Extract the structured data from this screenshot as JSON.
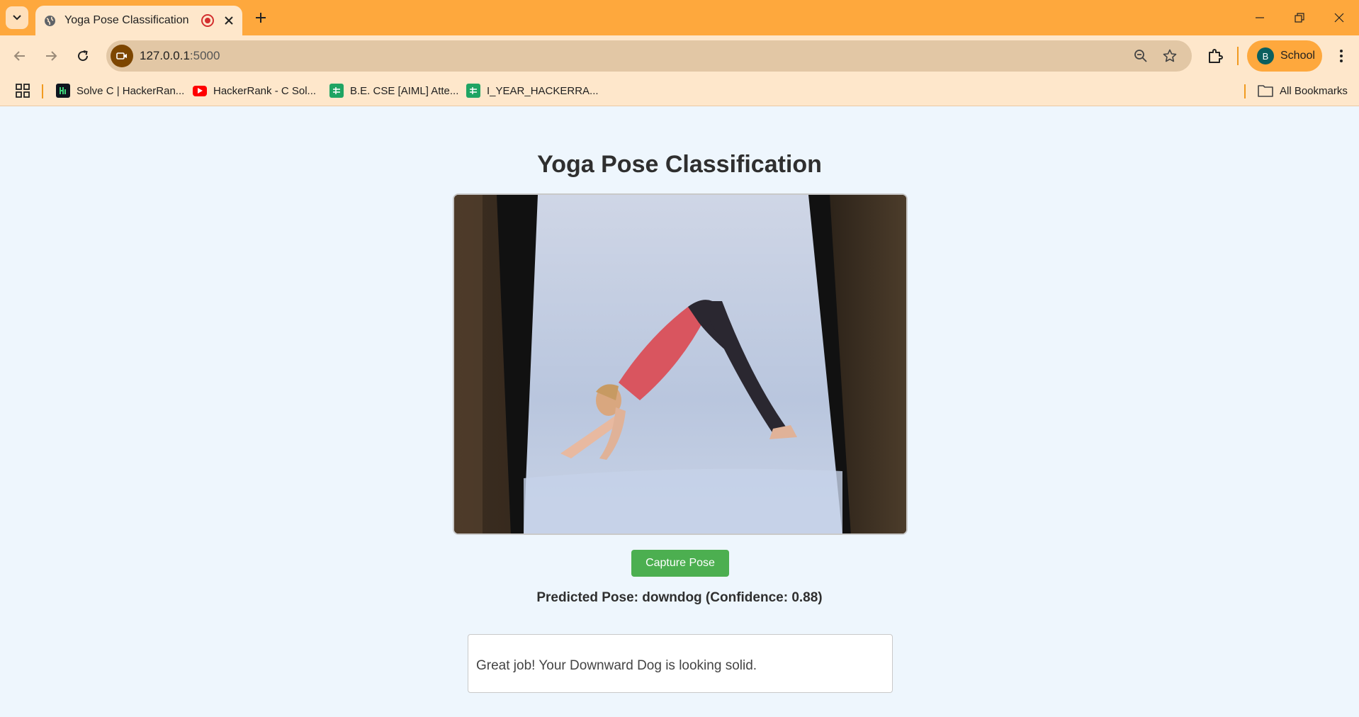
{
  "browser": {
    "tab": {
      "title": "Yoga Pose Classification"
    },
    "address": {
      "host": "127.0.0.1",
      "port": ":5000"
    },
    "profile": {
      "initial": "B",
      "name": "School"
    },
    "bookmarks": [
      {
        "label": "Solve C | HackerRan...",
        "icon": "hackerrank-icon"
      },
      {
        "label": "HackerRank - C Sol...",
        "icon": "youtube-icon"
      },
      {
        "label": "B.E. CSE [AIML] Atte...",
        "icon": "sheets-icon"
      },
      {
        "label": "I_YEAR_HACKERRA...",
        "icon": "sheets-icon"
      }
    ],
    "all_bookmarks_label": "All Bookmarks"
  },
  "page": {
    "title": "Yoga Pose Classification",
    "capture_button": "Capture Pose",
    "prediction": "Predicted Pose: downdog (Confidence: 0.88)",
    "feedback": "Great job! Your Downward Dog is looking solid."
  },
  "colors": {
    "tabstrip": "#fea83d",
    "toolbar": "#fee7cb",
    "page_bg": "#eef6fd",
    "button": "#4caf50",
    "record_indicator": "#d32f2f"
  }
}
